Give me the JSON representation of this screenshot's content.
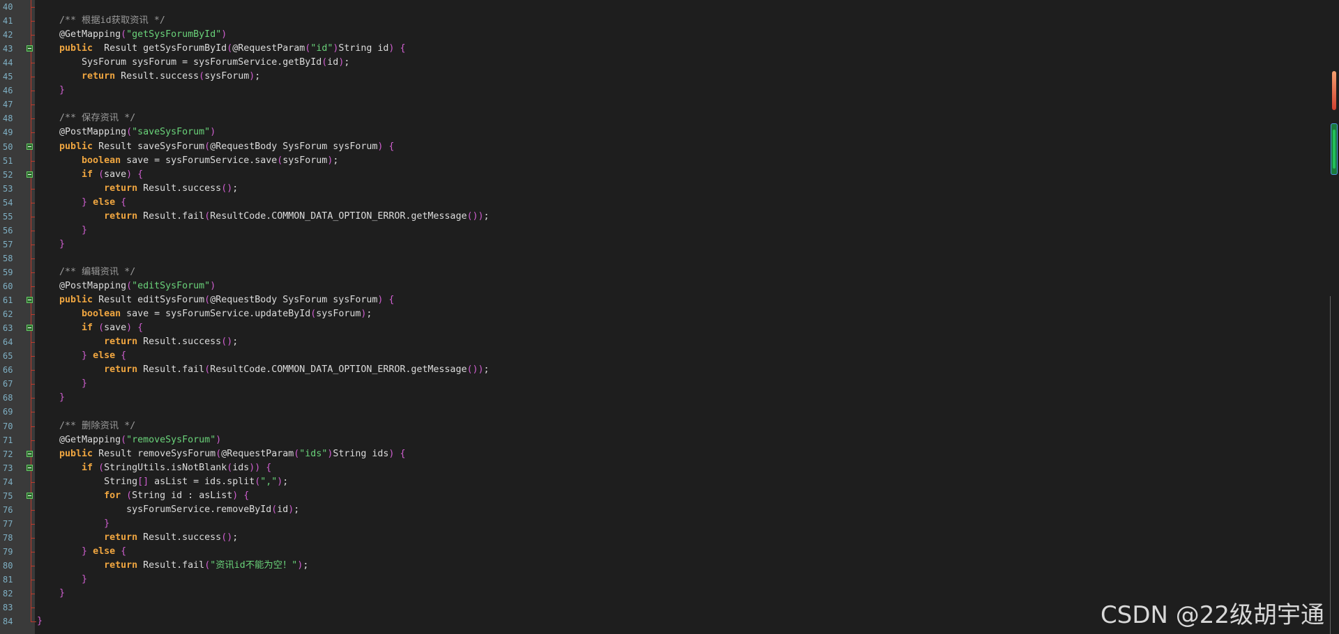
{
  "editor": {
    "first_line": 40,
    "lines": [
      {
        "n": "40",
        "fold": false,
        "tokens": []
      },
      {
        "n": "41",
        "fold": false,
        "tokens": [
          [
            "cm",
            "    /** 根据id获取资讯 */"
          ]
        ]
      },
      {
        "n": "42",
        "fold": false,
        "tokens": [
          [
            "ann",
            "    @GetMapping"
          ],
          [
            "pn",
            "("
          ],
          [
            "str",
            "\"getSysForumById\""
          ],
          [
            "pn",
            ")"
          ]
        ]
      },
      {
        "n": "43",
        "fold": true,
        "tokens": [
          [
            "kw",
            "    public"
          ],
          [
            "",
            "  Result getSysForumById"
          ],
          [
            "pn",
            "("
          ],
          [
            "",
            "@RequestParam"
          ],
          [
            "pn",
            "("
          ],
          [
            "str",
            "\"id\""
          ],
          [
            "pn",
            ")"
          ],
          [
            "",
            "String id"
          ],
          [
            "pn",
            ")"
          ],
          [
            "",
            " "
          ],
          [
            "pn",
            "{"
          ]
        ]
      },
      {
        "n": "44",
        "fold": false,
        "tokens": [
          [
            "",
            "        SysForum sysForum = sysForumService.getById"
          ],
          [
            "pn",
            "("
          ],
          [
            "",
            "id"
          ],
          [
            "pn",
            ")"
          ],
          [
            "",
            ";"
          ]
        ]
      },
      {
        "n": "45",
        "fold": false,
        "tokens": [
          [
            "kw",
            "        return"
          ],
          [
            "",
            " Result.success"
          ],
          [
            "pn",
            "("
          ],
          [
            "",
            "sysForum"
          ],
          [
            "pn",
            ")"
          ],
          [
            "",
            ";"
          ]
        ]
      },
      {
        "n": "46",
        "fold": false,
        "tokens": [
          [
            "pn",
            "    }"
          ]
        ]
      },
      {
        "n": "47",
        "fold": false,
        "tokens": []
      },
      {
        "n": "48",
        "fold": false,
        "tokens": [
          [
            "cm",
            "    /** 保存资讯 */"
          ]
        ]
      },
      {
        "n": "49",
        "fold": false,
        "tokens": [
          [
            "ann",
            "    @PostMapping"
          ],
          [
            "pn",
            "("
          ],
          [
            "str",
            "\"saveSysForum\""
          ],
          [
            "pn",
            ")"
          ]
        ]
      },
      {
        "n": "50",
        "fold": true,
        "tokens": [
          [
            "kw",
            "    public"
          ],
          [
            "",
            " Result saveSysForum"
          ],
          [
            "pn",
            "("
          ],
          [
            "",
            "@RequestBody SysForum sysForum"
          ],
          [
            "pn",
            ")"
          ],
          [
            "",
            " "
          ],
          [
            "pn",
            "{"
          ]
        ]
      },
      {
        "n": "51",
        "fold": false,
        "tokens": [
          [
            "kw",
            "        boolean"
          ],
          [
            "",
            " save = sysForumService.save"
          ],
          [
            "pn",
            "("
          ],
          [
            "",
            "sysForum"
          ],
          [
            "pn",
            ")"
          ],
          [
            "",
            ";"
          ]
        ]
      },
      {
        "n": "52",
        "fold": true,
        "tokens": [
          [
            "kw",
            "        if"
          ],
          [
            "",
            " "
          ],
          [
            "pn",
            "("
          ],
          [
            "",
            "save"
          ],
          [
            "pn",
            ")"
          ],
          [
            "",
            " "
          ],
          [
            "pn",
            "{"
          ]
        ]
      },
      {
        "n": "53",
        "fold": false,
        "tokens": [
          [
            "kw",
            "            return"
          ],
          [
            "",
            " Result.success"
          ],
          [
            "pn",
            "()"
          ],
          [
            "",
            ";"
          ]
        ]
      },
      {
        "n": "54",
        "fold": false,
        "tokens": [
          [
            "pn",
            "        }"
          ],
          [
            "",
            " "
          ],
          [
            "kw",
            "else"
          ],
          [
            "",
            " "
          ],
          [
            "pn",
            "{"
          ]
        ]
      },
      {
        "n": "55",
        "fold": false,
        "tokens": [
          [
            "kw",
            "            return"
          ],
          [
            "",
            " Result.fail"
          ],
          [
            "pn",
            "("
          ],
          [
            "",
            "ResultCode.COMMON_DATA_OPTION_ERROR.getMessage"
          ],
          [
            "pn",
            "())"
          ],
          [
            "",
            ";"
          ]
        ]
      },
      {
        "n": "56",
        "fold": false,
        "tokens": [
          [
            "pn",
            "        }"
          ]
        ]
      },
      {
        "n": "57",
        "fold": false,
        "tokens": [
          [
            "pn",
            "    }"
          ]
        ]
      },
      {
        "n": "58",
        "fold": false,
        "tokens": []
      },
      {
        "n": "59",
        "fold": false,
        "tokens": [
          [
            "cm",
            "    /** 编辑资讯 */"
          ]
        ]
      },
      {
        "n": "60",
        "fold": false,
        "tokens": [
          [
            "ann",
            "    @PostMapping"
          ],
          [
            "pn",
            "("
          ],
          [
            "str",
            "\"editSysForum\""
          ],
          [
            "pn",
            ")"
          ]
        ]
      },
      {
        "n": "61",
        "fold": true,
        "tokens": [
          [
            "kw",
            "    public"
          ],
          [
            "",
            " Result editSysForum"
          ],
          [
            "pn",
            "("
          ],
          [
            "",
            "@RequestBody SysForum sysForum"
          ],
          [
            "pn",
            ")"
          ],
          [
            "",
            " "
          ],
          [
            "pn",
            "{"
          ]
        ]
      },
      {
        "n": "62",
        "fold": false,
        "tokens": [
          [
            "kw",
            "        boolean"
          ],
          [
            "",
            " save = sysForumService.updateById"
          ],
          [
            "pn",
            "("
          ],
          [
            "",
            "sysForum"
          ],
          [
            "pn",
            ")"
          ],
          [
            "",
            ";"
          ]
        ]
      },
      {
        "n": "63",
        "fold": true,
        "tokens": [
          [
            "kw",
            "        if"
          ],
          [
            "",
            " "
          ],
          [
            "pn",
            "("
          ],
          [
            "",
            "save"
          ],
          [
            "pn",
            ")"
          ],
          [
            "",
            " "
          ],
          [
            "pn",
            "{"
          ]
        ]
      },
      {
        "n": "64",
        "fold": false,
        "tokens": [
          [
            "kw",
            "            return"
          ],
          [
            "",
            " Result.success"
          ],
          [
            "pn",
            "()"
          ],
          [
            "",
            ";"
          ]
        ]
      },
      {
        "n": "65",
        "fold": false,
        "tokens": [
          [
            "pn",
            "        }"
          ],
          [
            "",
            " "
          ],
          [
            "kw",
            "else"
          ],
          [
            "",
            " "
          ],
          [
            "pn",
            "{"
          ]
        ]
      },
      {
        "n": "66",
        "fold": false,
        "tokens": [
          [
            "kw",
            "            return"
          ],
          [
            "",
            " Result.fail"
          ],
          [
            "pn",
            "("
          ],
          [
            "",
            "ResultCode.COMMON_DATA_OPTION_ERROR.getMessage"
          ],
          [
            "pn",
            "())"
          ],
          [
            "",
            ";"
          ]
        ]
      },
      {
        "n": "67",
        "fold": false,
        "tokens": [
          [
            "pn",
            "        }"
          ]
        ]
      },
      {
        "n": "68",
        "fold": false,
        "tokens": [
          [
            "pn",
            "    }"
          ]
        ]
      },
      {
        "n": "69",
        "fold": false,
        "tokens": []
      },
      {
        "n": "70",
        "fold": false,
        "tokens": [
          [
            "cm",
            "    /** 删除资讯 */"
          ]
        ]
      },
      {
        "n": "71",
        "fold": false,
        "tokens": [
          [
            "ann",
            "    @GetMapping"
          ],
          [
            "pn",
            "("
          ],
          [
            "str",
            "\"removeSysForum\""
          ],
          [
            "pn",
            ")"
          ]
        ]
      },
      {
        "n": "72",
        "fold": true,
        "tokens": [
          [
            "kw",
            "    public"
          ],
          [
            "",
            " Result removeSysForum"
          ],
          [
            "pn",
            "("
          ],
          [
            "",
            "@RequestParam"
          ],
          [
            "pn",
            "("
          ],
          [
            "str",
            "\"ids\""
          ],
          [
            "pn",
            ")"
          ],
          [
            "",
            "String ids"
          ],
          [
            "pn",
            ")"
          ],
          [
            "",
            " "
          ],
          [
            "pn",
            "{"
          ]
        ]
      },
      {
        "n": "73",
        "fold": true,
        "tokens": [
          [
            "kw",
            "        if"
          ],
          [
            "",
            " "
          ],
          [
            "pn",
            "("
          ],
          [
            "",
            "StringUtils.isNotBlank"
          ],
          [
            "pn",
            "("
          ],
          [
            "",
            "ids"
          ],
          [
            "pn",
            "))"
          ],
          [
            "",
            " "
          ],
          [
            "pn",
            "{"
          ]
        ]
      },
      {
        "n": "74",
        "fold": false,
        "tokens": [
          [
            "",
            "            String"
          ],
          [
            "pn",
            "[]"
          ],
          [
            "",
            " asList = ids.split"
          ],
          [
            "pn",
            "("
          ],
          [
            "str",
            "\",\""
          ],
          [
            "pn",
            ")"
          ],
          [
            "",
            ";"
          ]
        ]
      },
      {
        "n": "75",
        "fold": true,
        "tokens": [
          [
            "kw",
            "            for"
          ],
          [
            "",
            " "
          ],
          [
            "pn",
            "("
          ],
          [
            "",
            "String id : asList"
          ],
          [
            "pn",
            ")"
          ],
          [
            "",
            " "
          ],
          [
            "pn",
            "{"
          ]
        ]
      },
      {
        "n": "76",
        "fold": false,
        "tokens": [
          [
            "",
            "                sysForumService.removeById"
          ],
          [
            "pn",
            "("
          ],
          [
            "",
            "id"
          ],
          [
            "pn",
            ")"
          ],
          [
            "",
            ";"
          ]
        ]
      },
      {
        "n": "77",
        "fold": false,
        "tokens": [
          [
            "pn",
            "            }"
          ]
        ]
      },
      {
        "n": "78",
        "fold": false,
        "tokens": [
          [
            "kw",
            "            return"
          ],
          [
            "",
            " Result.success"
          ],
          [
            "pn",
            "()"
          ],
          [
            "",
            ";"
          ]
        ]
      },
      {
        "n": "79",
        "fold": false,
        "tokens": [
          [
            "pn",
            "        }"
          ],
          [
            "",
            " "
          ],
          [
            "kw",
            "else"
          ],
          [
            "",
            " "
          ],
          [
            "pn",
            "{"
          ]
        ]
      },
      {
        "n": "80",
        "fold": false,
        "tokens": [
          [
            "kw",
            "            return"
          ],
          [
            "",
            " Result.fail"
          ],
          [
            "pn",
            "("
          ],
          [
            "str",
            "\"资讯id不能为空！\""
          ],
          [
            "pn",
            ")"
          ],
          [
            "",
            ";"
          ]
        ]
      },
      {
        "n": "81",
        "fold": false,
        "tokens": [
          [
            "pn",
            "        }"
          ]
        ]
      },
      {
        "n": "82",
        "fold": false,
        "tokens": [
          [
            "pn",
            "    }"
          ]
        ]
      },
      {
        "n": "83",
        "fold": false,
        "tokens": []
      },
      {
        "n": "84",
        "fold": false,
        "tokens": [
          [
            "pn",
            "}"
          ]
        ]
      }
    ]
  },
  "colors": {
    "background": "#1e1e1e",
    "gutter": "#3a3a3a",
    "keyword": "#f0a640",
    "string": "#6ad37a",
    "comment": "#9a9a9a",
    "punctuation": "#d05fd0",
    "line_number": "#7fb0c4",
    "fold_line": "#c0392b"
  },
  "watermark": "CSDN @22级胡宇通"
}
